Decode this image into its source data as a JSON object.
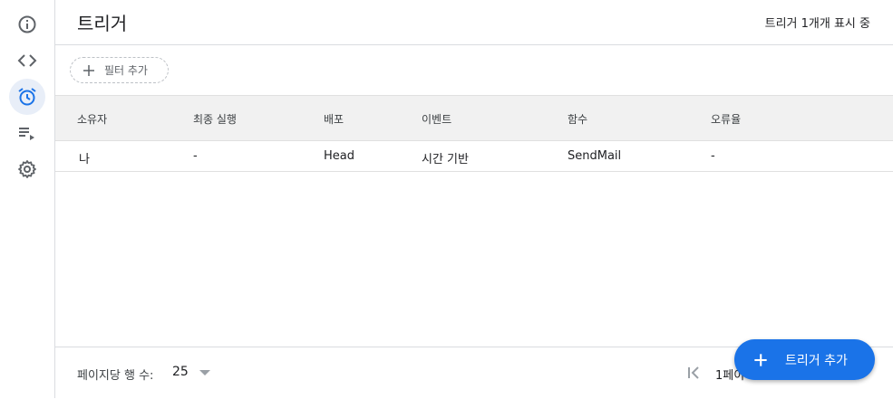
{
  "rail": {
    "items": [
      {
        "name": "overview",
        "icon": "info-icon",
        "active": false
      },
      {
        "name": "editor",
        "icon": "code-icon",
        "active": false
      },
      {
        "name": "triggers",
        "icon": "alarm-clock-icon",
        "active": true
      },
      {
        "name": "executions",
        "icon": "playlist-play-icon",
        "active": false
      },
      {
        "name": "settings",
        "icon": "gear-icon",
        "active": false
      }
    ],
    "accent_color": "#1a73e8"
  },
  "header": {
    "title": "트리거",
    "count_text": "트리거 1개개 표시 중"
  },
  "filter": {
    "add_filter_label": "필터 추가"
  },
  "table": {
    "columns": [
      "소유자",
      "최종 실행",
      "배포",
      "이벤트",
      "함수",
      "오류율"
    ],
    "rows": [
      [
        "나",
        "-",
        "Head",
        "시간 기반",
        "SendMail",
        "-"
      ]
    ]
  },
  "footer": {
    "rows_per_page_label": "페이지당 행 수:",
    "rows_per_page_value": "25",
    "page_text": "1페이"
  },
  "fab": {
    "label": "트리거 추가",
    "color": "#1a73e8"
  }
}
